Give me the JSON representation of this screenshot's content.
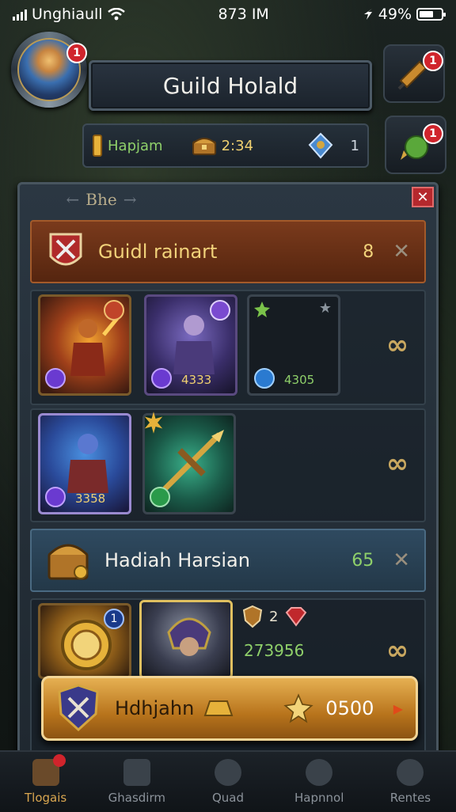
{
  "status_bar": {
    "carrier": "Unghiaull",
    "time": "873 IM",
    "battery": "49%"
  },
  "header": {
    "title": "Guild Holald",
    "avatar_badge": "1",
    "resources": [
      {
        "label": "Hapjam",
        "icon": "gold-bar-icon"
      },
      {
        "label": "2:34",
        "icon": "treasure-chest-icon"
      },
      {
        "label": "1",
        "icon": "crystal-icon"
      }
    ],
    "side_buttons": [
      {
        "icon": "bell-icon",
        "badge": "1"
      },
      {
        "icon": "potion-icon",
        "badge": "1"
      }
    ]
  },
  "panel": {
    "tab_label": "Bhe",
    "sections": [
      {
        "title": "Guidl rainart",
        "count": "8"
      },
      {
        "title": "Hadiah Harsian",
        "count": "65"
      }
    ],
    "row1_cards": [
      {
        "value": "",
        "icon": "flame-warrior-icon"
      },
      {
        "value": "4333",
        "icon": "dark-knight-icon"
      },
      {
        "value": "4305",
        "icon": "empty-slot-icon"
      }
    ],
    "row2_cards": [
      {
        "value": "3358",
        "icon": "blue-mage-icon"
      },
      {
        "value": "",
        "icon": "crossbow-icon"
      }
    ],
    "row3": {
      "badge": "1",
      "mini_count": "2",
      "value": "273956"
    }
  },
  "banner": {
    "name": "Hdhjahn",
    "value": "0500"
  },
  "nav": [
    {
      "label": "Tlogais",
      "icon": "guild-hall-icon",
      "active": true
    },
    {
      "label": "Ghasdirm",
      "icon": "anvil-icon",
      "active": false
    },
    {
      "label": "Quad",
      "icon": "shield-icon",
      "active": false
    },
    {
      "label": "Hapnnol",
      "icon": "sword-icon",
      "active": false
    },
    {
      "label": "Rentes",
      "icon": "gear-icon",
      "active": false
    }
  ],
  "colors": {
    "accent": "#d9a650",
    "red": "#d0242c",
    "green": "#7ac24a"
  }
}
